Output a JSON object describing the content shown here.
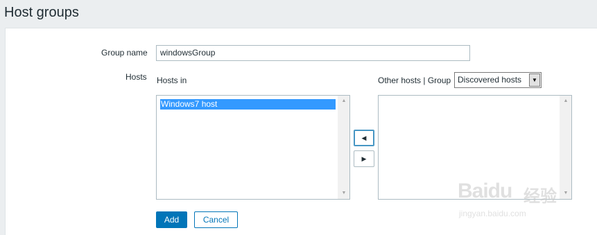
{
  "header": {
    "title": "Host groups"
  },
  "form": {
    "group_name_label": "Group name",
    "group_name_value": "windowsGroup",
    "hosts_label": "Hosts",
    "hosts_in_label": "Hosts in",
    "hosts_in_options": [
      "Windows7 host"
    ],
    "other_hosts_label": "Other hosts | Group",
    "group_select_value": "Discovered hosts",
    "other_hosts_options": []
  },
  "buttons": {
    "move_left": "◀",
    "move_right": "▶",
    "add": "Add",
    "cancel": "Cancel"
  },
  "icons": {
    "scroll_up": "▲",
    "scroll_down": "▼",
    "dropdown": "▼"
  },
  "watermark": {
    "brand": "Baidu",
    "brand_cn": "经验",
    "url": "jingyan.baidu.com"
  },
  "colors": {
    "accent": "#0275b8",
    "selection": "#3399ff",
    "background": "#ebeef0"
  }
}
